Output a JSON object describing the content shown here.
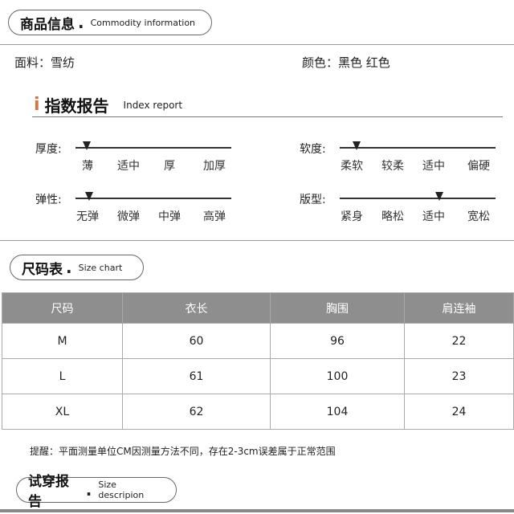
{
  "commodity": {
    "title_cn": "商品信息",
    "dot": ".",
    "title_en": "Commodity information",
    "material": "面料：雪纺",
    "color": "颜色：黑色 红色"
  },
  "index_report": {
    "icon": "i",
    "title_cn": "指数报告",
    "title_en": "Index report",
    "metrics": [
      {
        "label": "厚度:",
        "options": [
          "薄",
          "适中",
          "厚",
          "加厚"
        ],
        "marker_level": 0.07
      },
      {
        "label": "软度:",
        "options": [
          "柔软",
          "较柔",
          "适中",
          "偏硬"
        ],
        "marker_level": 0.11
      },
      {
        "label": "弹性:",
        "options": [
          "无弹",
          "微弹",
          "中弹",
          "高弹"
        ],
        "marker_level": 0.09
      },
      {
        "label": "版型:",
        "options": [
          "紧身",
          "略松",
          "适中",
          "宽松"
        ],
        "marker_level": 0.64
      }
    ]
  },
  "size_chart": {
    "title_cn": "尺码表",
    "dot": ".",
    "title_en": "Size chart",
    "headers": [
      "尺码",
      "衣长",
      "胸围",
      "肩连袖"
    ],
    "rows": [
      [
        "M",
        "60",
        "96",
        "22"
      ],
      [
        "L",
        "61",
        "100",
        "23"
      ],
      [
        "XL",
        "62",
        "104",
        "24"
      ]
    ],
    "note": "提醒：平面测量单位CM因测量方法不同，存在2-3cm误差属于正常范围"
  },
  "fitting_report": {
    "title_cn": "试穿报告",
    "dot": ".",
    "title_en": "Size descripion"
  }
}
